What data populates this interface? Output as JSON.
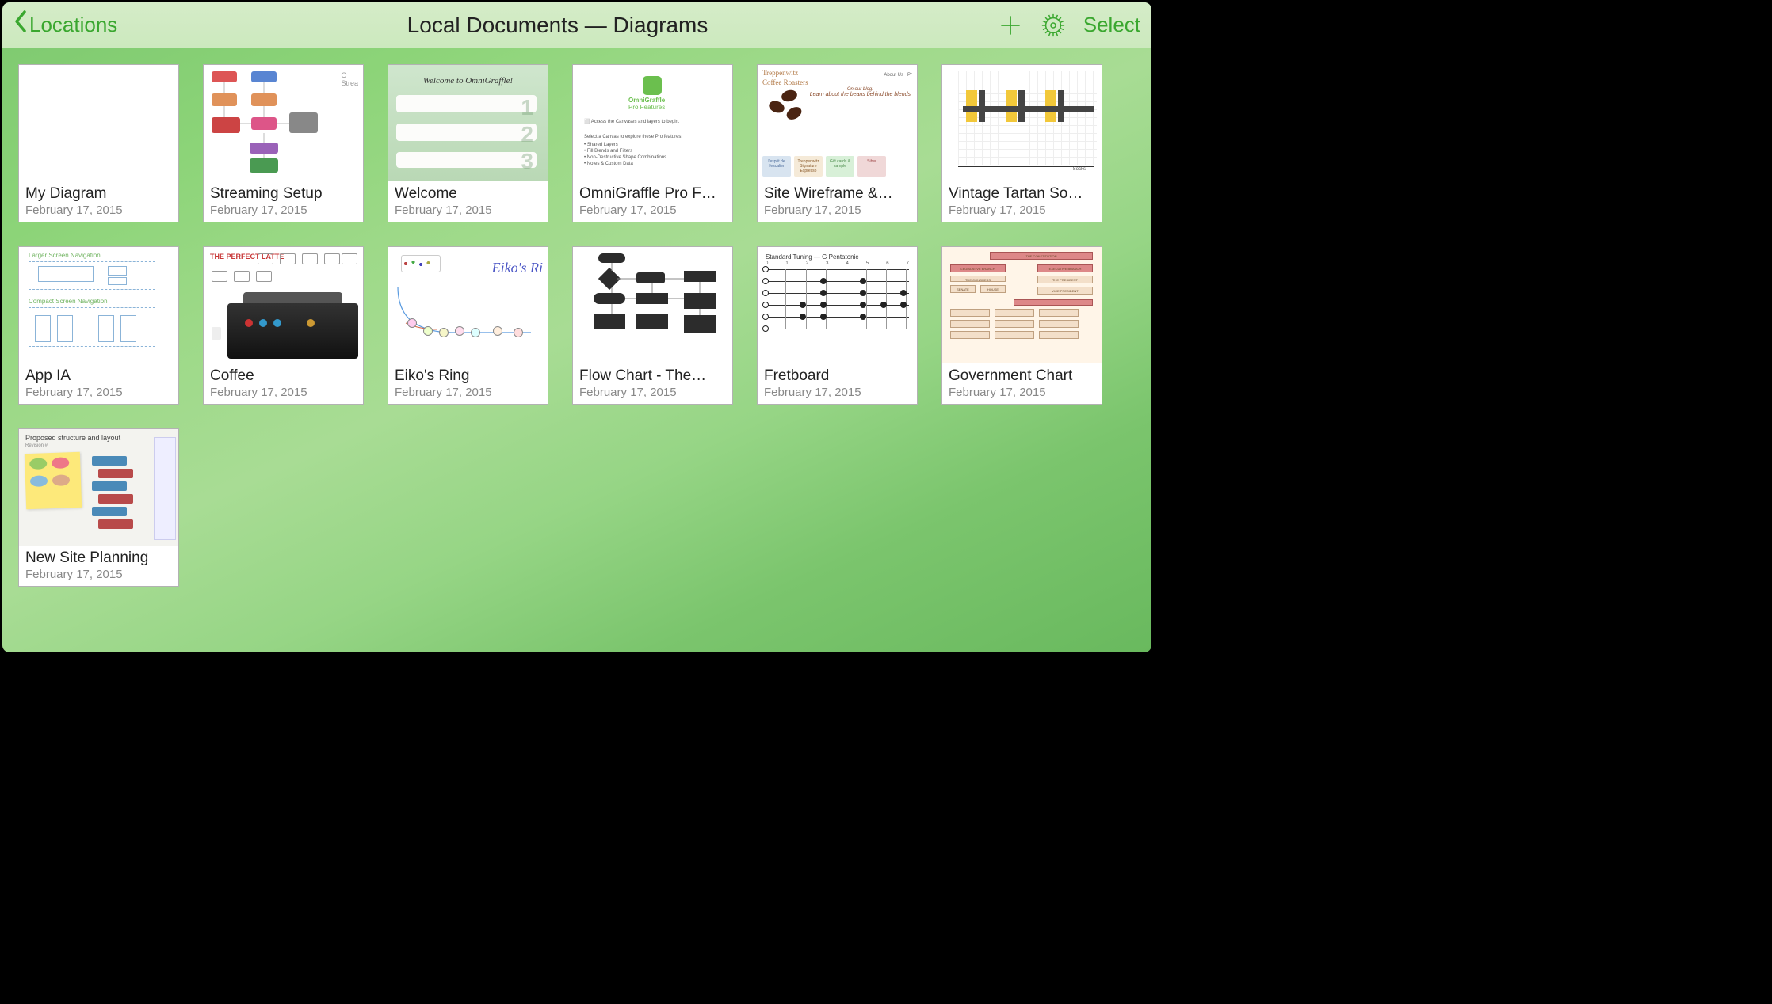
{
  "toolbar": {
    "back_label": "Locations",
    "title": "Local Documents — Diagrams",
    "select_label": "Select"
  },
  "documents": [
    {
      "title": "My Diagram",
      "date": "February 17, 2015"
    },
    {
      "title": "Streaming Setup",
      "date": "February 17, 2015"
    },
    {
      "title": "Welcome",
      "date": "February 17, 2015"
    },
    {
      "title": "OmniGraffle Pro F…",
      "date": "February 17, 2015"
    },
    {
      "title": "Site Wireframe &…",
      "date": "February 17, 2015"
    },
    {
      "title": "Vintage Tartan So…",
      "date": "February 17, 2015"
    },
    {
      "title": "App IA",
      "date": "February 17, 2015"
    },
    {
      "title": "Coffee",
      "date": "February 17, 2015"
    },
    {
      "title": "Eiko's Ring",
      "date": "February 17, 2015"
    },
    {
      "title": "Flow Chart - The…",
      "date": "February 17, 2015"
    },
    {
      "title": "Fretboard",
      "date": "February 17, 2015"
    },
    {
      "title": "Government Chart",
      "date": "February 17, 2015"
    },
    {
      "title": "New Site Planning",
      "date": "February 17, 2015"
    }
  ],
  "thumbs": {
    "welcome_text": "Welcome to OmniGraffle!",
    "pro_text": "OmniGraffle",
    "pro_sub": "Pro Features",
    "wire_header": "Treppenwitz",
    "wire_sub": "Coffee Roasters",
    "wire_blog": "On our blog:",
    "wire_tag": "Learn about the beans behind the blends",
    "coffee_header": "THE PERFECT LATTE",
    "eiko_title": "Eiko's Ri",
    "fret_title": "Standard Tuning — G Pentatonic",
    "appia_h1": "Larger Screen Navigation",
    "appia_h2": "Compact Screen Navigation",
    "plan_header": "Proposed structure and layout",
    "plan_sub": "Revision #"
  }
}
